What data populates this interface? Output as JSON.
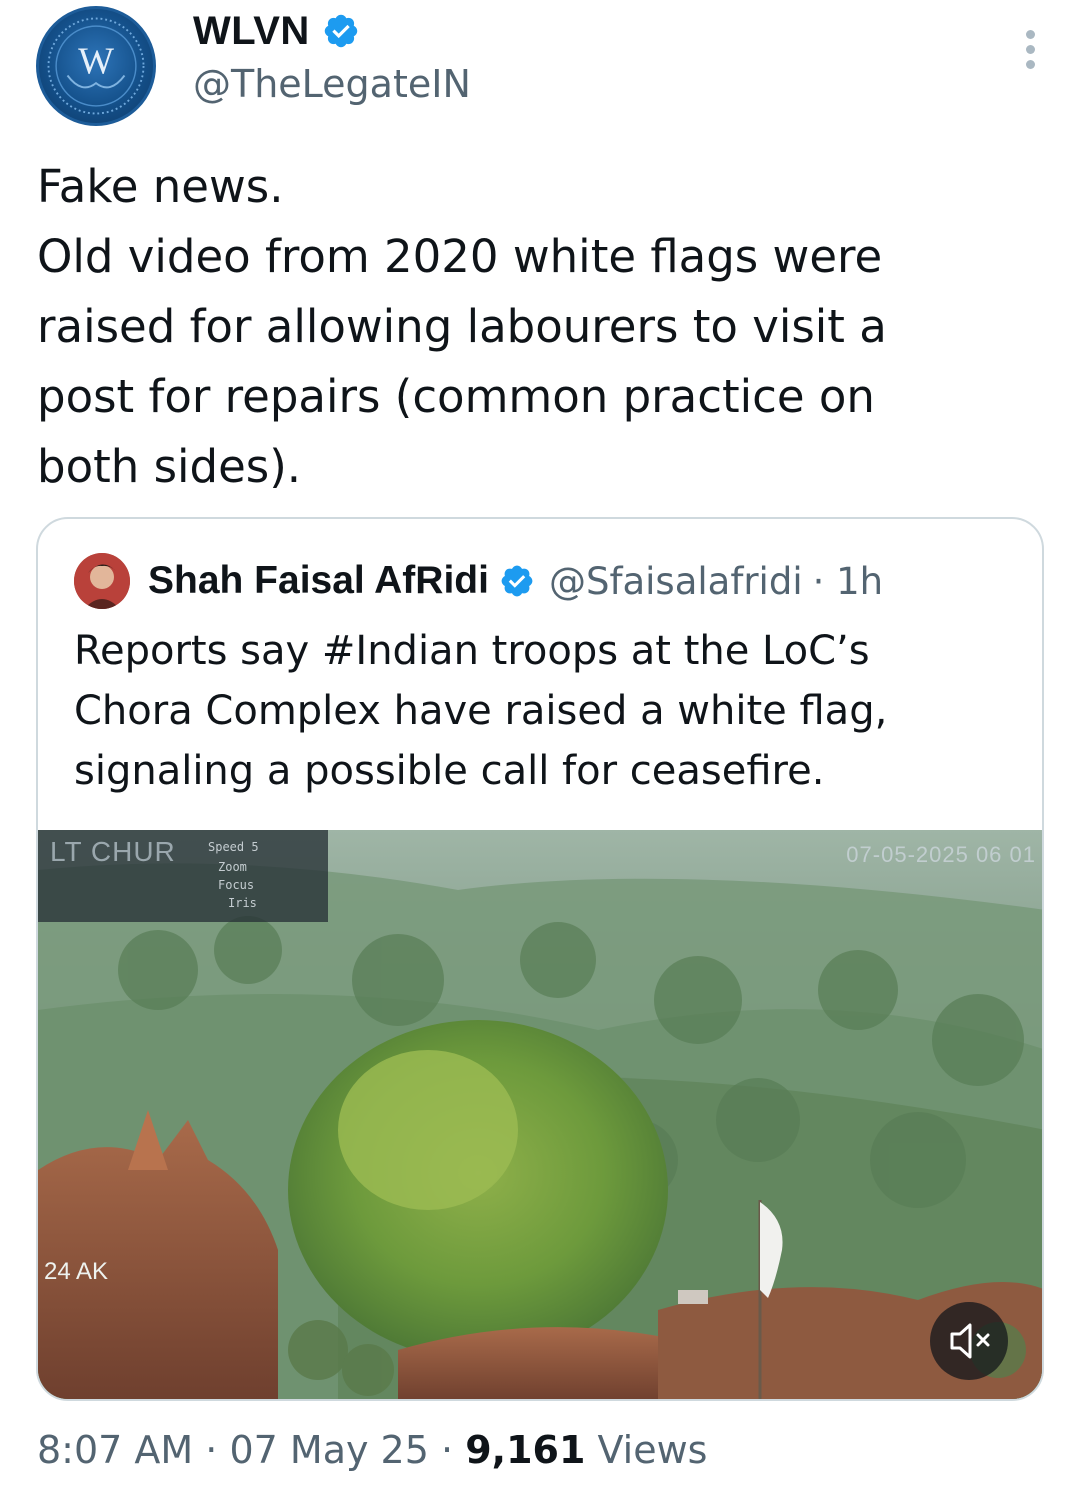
{
  "author": {
    "name": "WLVN",
    "handle": "@TheLegateIN",
    "avatar_letter": "W",
    "verified_icon": "verified-badge-icon"
  },
  "tweet": {
    "lines": [
      "Fake news.",
      "Old video from 2020 white flags were",
      "raised for allowing labourers to visit a",
      "post for repairs (common practice on",
      "both sides)."
    ]
  },
  "quoted": {
    "name": "Shah Faisal AfRidi",
    "handle": "@Sfaisalafridi",
    "time": "· 1h",
    "lines": [
      "Reports say #Indian troops at the LoC’s",
      "Chora Complex have raised a white flag,",
      "signaling a possible call for ceasefire."
    ],
    "video": {
      "overlay_title": "LT CHUR",
      "overlay_speed": "Speed 5",
      "overlay_zoom": "Zoom",
      "overlay_focus": "Focus",
      "overlay_iris": "Iris",
      "timestamp": "07-05-2025 06 01",
      "corner_label": "24 AK",
      "mute_icon": "muted-speaker-icon"
    }
  },
  "footer": {
    "time": "8:07 AM",
    "date": "07 May 25",
    "views_count": "9,161",
    "views_label": "Views",
    "sep": "·"
  },
  "colors": {
    "text": "#0f1419",
    "secondary": "#536471",
    "verified": "#1d9bf0",
    "border": "#cfd9de"
  }
}
